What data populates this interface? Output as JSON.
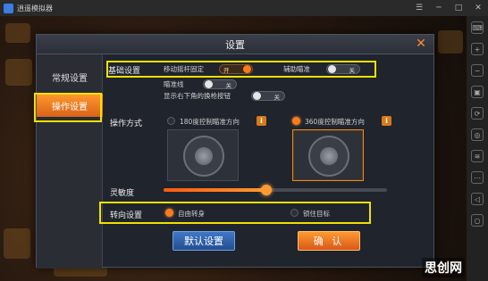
{
  "window": {
    "title": "逍遥模拟器"
  },
  "dialog": {
    "title": "设置",
    "tabs": [
      {
        "label": "常规设置",
        "active": false
      },
      {
        "label": "操作设置",
        "active": true
      }
    ],
    "basic": {
      "label": "基础设置",
      "fixed_joystick": {
        "label": "移动摇杆固定",
        "state": "开",
        "on": true
      },
      "aim_assist": {
        "label": "辅助瞄准",
        "state": "关",
        "on": false
      },
      "crosshair": {
        "label": "瞄准线",
        "state": "关",
        "on": false
      },
      "show_switch_gun": {
        "label": "显示右下角的换枪按钮",
        "state": "关",
        "on": false
      }
    },
    "control_mode": {
      "label": "操作方式",
      "options": [
        {
          "label": "180度控制瞄准方向",
          "selected": false
        },
        {
          "label": "360度控制瞄准方向",
          "selected": true
        }
      ]
    },
    "sensitivity": {
      "label": "灵敏度",
      "value": 0.46
    },
    "turning": {
      "label": "转向设置",
      "options": [
        {
          "label": "自由转身",
          "selected": true
        },
        {
          "label": "锁住目标",
          "selected": false
        }
      ]
    },
    "buttons": {
      "reset": "默认设置",
      "confirm": "确 认"
    }
  },
  "watermark": "思创网",
  "colors": {
    "accent": "#ff7a18",
    "highlight": "#f2e000",
    "blue_button": "#3f78c8"
  }
}
